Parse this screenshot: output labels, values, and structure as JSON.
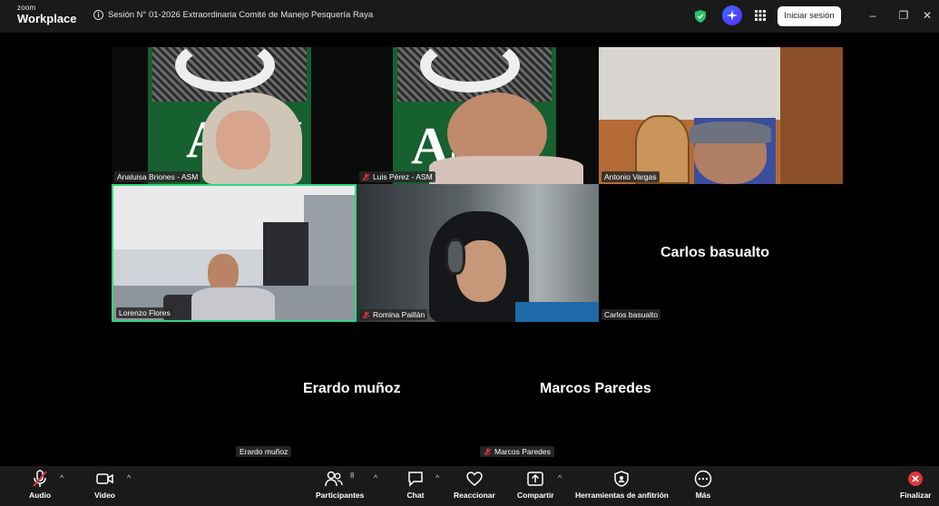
{
  "titlebar": {
    "brand_small": "zoom",
    "brand_large": "Workplace",
    "info_glyph": "i",
    "meeting_title": "Sesión N° 01-2026 Extraordinaria Comité de Manejo Pesquería Raya",
    "signin_label": "Iniciar sesión",
    "minimize_glyph": "–",
    "maximize_glyph": "❐",
    "close_glyph": "✕"
  },
  "participants_video": [
    {
      "name": "Analuisa Briones - ASM",
      "muted": false
    },
    {
      "name": "Luis Pérez - ASM",
      "muted": true
    },
    {
      "name": "Antonio Vargas",
      "muted": false
    },
    {
      "name": "Lorenzo Flores",
      "muted": false,
      "active_speaker": true
    },
    {
      "name": "Romina Paillán",
      "muted": true
    }
  ],
  "participants_no_video": [
    {
      "display": "Carlos  basualto",
      "tag": "Carlos  basualto"
    },
    {
      "display": "Erardo muñoz",
      "tag": "Erardo muñoz"
    },
    {
      "display": "Marcos Paredes",
      "tag": "Marcos Paredes",
      "muted": true
    }
  ],
  "toolbar": {
    "audio": "Audio",
    "video": "Video",
    "participants": "Participantes",
    "participants_count": "8",
    "chat": "Chat",
    "react": "Reaccionar",
    "share": "Compartir",
    "host_tools": "Herramientas de anfitrión",
    "more": "Más",
    "end": "Finalizar",
    "caret": "^"
  },
  "colors": {
    "active_speaker_border": "#2fd67a",
    "mute_red": "#e0353a",
    "shield_green": "#27c26c",
    "end_red": "#e0353a"
  },
  "icons": [
    "info-icon",
    "shield-icon",
    "ai-sparkle-icon",
    "apps-grid-icon",
    "mic-muted-icon",
    "camera-icon",
    "participants-icon",
    "chat-icon",
    "heart-icon",
    "share-icon",
    "shield-host-icon",
    "more-icon",
    "end-icon"
  ]
}
